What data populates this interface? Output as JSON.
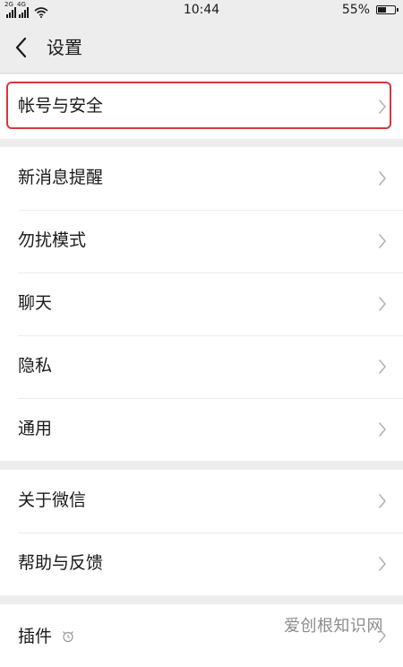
{
  "status_bar": {
    "signal_1_label": "2G",
    "signal_2_label": "4G",
    "time": "10:44",
    "battery_text": "55%",
    "battery_level": 0.55
  },
  "header": {
    "title": "设置",
    "back_icon": "chevron-left-icon"
  },
  "groups": [
    {
      "items": [
        {
          "label": "帐号与安全",
          "highlighted": true
        }
      ]
    },
    {
      "items": [
        {
          "label": "新消息提醒"
        },
        {
          "label": "勿扰模式"
        },
        {
          "label": "聊天"
        },
        {
          "label": "隐私"
        },
        {
          "label": "通用"
        }
      ]
    },
    {
      "items": [
        {
          "label": "关于微信"
        },
        {
          "label": "帮助与反馈"
        }
      ]
    },
    {
      "items": [
        {
          "label": "插件",
          "icon": "plugin-icon"
        }
      ]
    }
  ],
  "watermark": "爱创根知识网",
  "colors": {
    "background": "#ededed",
    "row_background": "#ffffff",
    "highlight_border": "#d9363e",
    "text": "#1a1a1a",
    "chevron": "#b2b2b2"
  }
}
